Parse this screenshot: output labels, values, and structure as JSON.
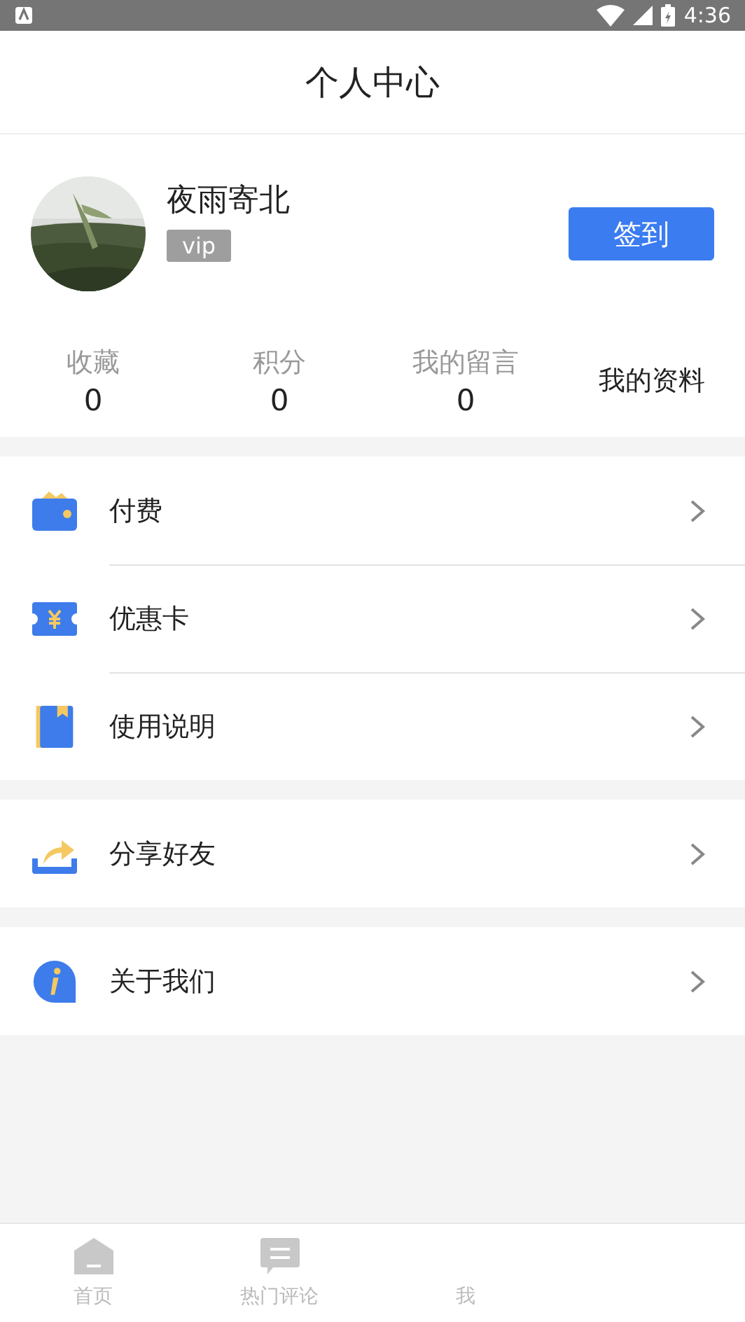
{
  "status_bar": {
    "time": "4:36"
  },
  "header": {
    "title": "个人中心"
  },
  "profile": {
    "name": "夜雨寄北",
    "badge": "vip",
    "button": "签到"
  },
  "stats": [
    {
      "label": "收藏",
      "value": "0"
    },
    {
      "label": "积分",
      "value": "0"
    },
    {
      "label": "我的留言",
      "value": "0"
    }
  ],
  "profile_link": "我的资料",
  "menu_groups": [
    [
      {
        "kind": "wallet",
        "label": "付费"
      },
      {
        "kind": "coupon",
        "label": "优惠卡"
      },
      {
        "kind": "book",
        "label": "使用说明"
      }
    ],
    [
      {
        "kind": "share",
        "label": "分享好友"
      }
    ],
    [
      {
        "kind": "info",
        "label": "关于我们"
      }
    ]
  ],
  "tabs": [
    {
      "kind": "home",
      "label": "首页",
      "selected": false
    },
    {
      "kind": "comment",
      "label": "热门评论",
      "selected": false
    },
    {
      "kind": "none",
      "label": "我",
      "selected": false
    }
  ]
}
